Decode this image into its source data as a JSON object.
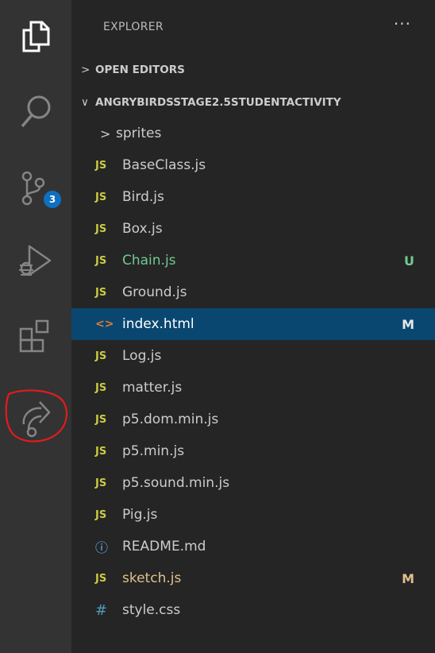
{
  "activity_bar": {
    "icons": [
      "files-icon",
      "search-icon",
      "source-control-icon",
      "run-debug-icon",
      "extensions-icon",
      "live-share-icon"
    ],
    "source_control_badge": "3",
    "annotation_color": "#e21b1b"
  },
  "explorer": {
    "title": "EXPLORER",
    "more_label": "···",
    "open_editors_label": "OPEN EDITORS",
    "project_label": "ANGRYBIRDSSTAGE2.5STUDENTACTIVITY",
    "items": [
      {
        "name": "sprites",
        "type": "folder",
        "icon": "chevron-right-icon",
        "status": ""
      },
      {
        "name": "BaseClass.js",
        "type": "js",
        "icon": "JS",
        "status": ""
      },
      {
        "name": "Bird.js",
        "type": "js",
        "icon": "JS",
        "status": ""
      },
      {
        "name": "Box.js",
        "type": "js",
        "icon": "JS",
        "status": ""
      },
      {
        "name": "Chain.js",
        "type": "js",
        "icon": "JS",
        "status": "U"
      },
      {
        "name": "Ground.js",
        "type": "js",
        "icon": "JS",
        "status": ""
      },
      {
        "name": "index.html",
        "type": "html",
        "icon": "<>",
        "status": "M"
      },
      {
        "name": "Log.js",
        "type": "js",
        "icon": "JS",
        "status": ""
      },
      {
        "name": "matter.js",
        "type": "js",
        "icon": "JS",
        "status": ""
      },
      {
        "name": "p5.dom.min.js",
        "type": "js",
        "icon": "JS",
        "status": ""
      },
      {
        "name": "p5.min.js",
        "type": "js",
        "icon": "JS",
        "status": ""
      },
      {
        "name": "p5.sound.min.js",
        "type": "js",
        "icon": "JS",
        "status": ""
      },
      {
        "name": "Pig.js",
        "type": "js",
        "icon": "JS",
        "status": ""
      },
      {
        "name": "README.md",
        "type": "info",
        "icon": "ⓘ",
        "status": ""
      },
      {
        "name": "sketch.js",
        "type": "js",
        "icon": "JS",
        "status": "M"
      },
      {
        "name": "style.css",
        "type": "css",
        "icon": "#",
        "status": ""
      }
    ],
    "selected_item": "index.html",
    "colors": {
      "untracked": "#73c991",
      "modified": "#e2c08d",
      "selected_bg": "#094771",
      "js_icon": "#cbcb41"
    }
  }
}
